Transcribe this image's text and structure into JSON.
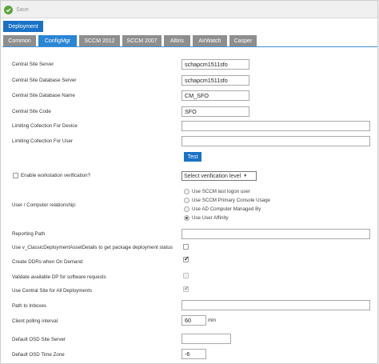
{
  "toolbar": {
    "save_label": "Save"
  },
  "deployment_tab": "Deployment",
  "tabs": [
    {
      "label": "Common"
    },
    {
      "label": "ConfigMgr"
    },
    {
      "label": "SCCM 2012"
    },
    {
      "label": "SCCM 2007"
    },
    {
      "label": "Altiris"
    },
    {
      "label": "AirWatch"
    },
    {
      "label": "Casper"
    }
  ],
  "active_tab": "ConfigMgr",
  "colors": {
    "accent": "#1a72c7",
    "tab_inactive": "#8e8e8e",
    "save_icon": "#5aa33a"
  },
  "form": {
    "central_site_server": {
      "label": "Central Site Server",
      "value": "schapcm1511sfo"
    },
    "central_site_db_server": {
      "label": "Central Site Database Server",
      "value": "schapcm1511sfo"
    },
    "central_site_db_name": {
      "label": "Central Site Database Name",
      "value": "CM_SFO"
    },
    "central_site_code": {
      "label": "Central Site Code",
      "value": "SFO"
    },
    "limiting_collection_device": {
      "label": "Limiting Collection For Device",
      "value": ""
    },
    "limiting_collection_user": {
      "label": "Limiting Collection For User",
      "value": ""
    },
    "test_button": "Test",
    "workstation_verification": {
      "label": "Enable workstation verification?",
      "checked": false,
      "select_value": "Select verification level"
    },
    "user_computer_relationship": {
      "label": "User / Computer relationship:",
      "options": [
        {
          "label": "Use SCCM last logon user",
          "checked": false
        },
        {
          "label": "Use SCCM Primary Console Usage",
          "checked": false
        },
        {
          "label": "Use AD Computer Managed By",
          "checked": false
        },
        {
          "label": "Use User Affinity",
          "checked": true
        }
      ]
    },
    "reporting_path": {
      "label": "Reporting Path",
      "value": ""
    },
    "use_classic_details": {
      "label": "Use v_ClassicDeploymentAssetDetails to get package deployment status",
      "checked": false
    },
    "create_ddrs": {
      "label": "Create DDRs when On Demand",
      "checked": true
    },
    "validate_dp": {
      "label": "Validate available DP for software requests",
      "checked": false
    },
    "use_central_site": {
      "label": "Use Central Site for All Deployments",
      "checked": true
    },
    "path_to_inboxes": {
      "label": "Path to Inboxes",
      "value": ""
    },
    "client_polling_interval": {
      "label": "Client polling interval",
      "value": "60",
      "unit": "min"
    },
    "default_osd_site_server": {
      "label": "Default OSD Site Server",
      "value": ""
    },
    "default_osd_time_zone": {
      "label": "Default OSD Time Zone",
      "value": "-6"
    }
  }
}
